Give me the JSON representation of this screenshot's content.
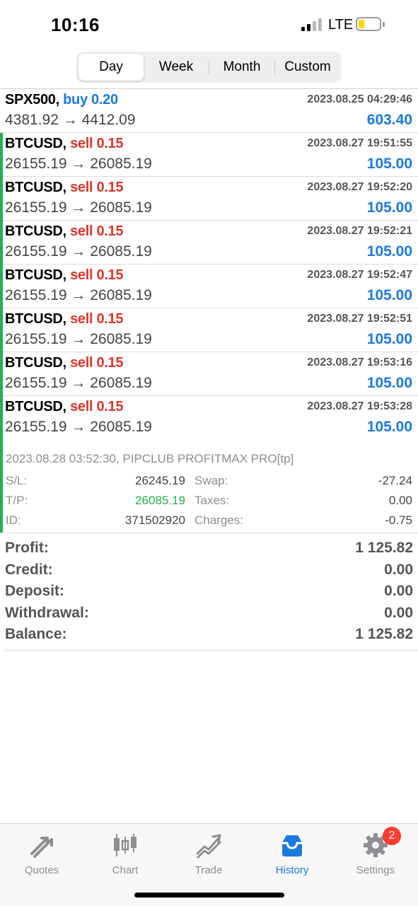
{
  "status_bar": {
    "time": "10:16",
    "network": "LTE"
  },
  "period_tabs": [
    "Day",
    "Week",
    "Month",
    "Custom"
  ],
  "active_period": "Day",
  "trades": [
    {
      "symbol": "SPX500,",
      "side": "buy 0.20",
      "side_type": "buy",
      "datetime": "2023.08.25 04:29:46",
      "prices": "4381.92 → 4412.09",
      "profit": "603.40"
    },
    {
      "symbol": "BTCUSD,",
      "side": "sell 0.15",
      "side_type": "sell",
      "datetime": "2023.08.27 19:51:55",
      "prices": "26155.19 → 26085.19",
      "profit": "105.00"
    },
    {
      "symbol": "BTCUSD,",
      "side": "sell 0.15",
      "side_type": "sell",
      "datetime": "2023.08.27 19:52:20",
      "prices": "26155.19 → 26085.19",
      "profit": "105.00"
    },
    {
      "symbol": "BTCUSD,",
      "side": "sell 0.15",
      "side_type": "sell",
      "datetime": "2023.08.27 19:52:21",
      "prices": "26155.19 → 26085.19",
      "profit": "105.00"
    },
    {
      "symbol": "BTCUSD,",
      "side": "sell 0.15",
      "side_type": "sell",
      "datetime": "2023.08.27 19:52:47",
      "prices": "26155.19 → 26085.19",
      "profit": "105.00"
    },
    {
      "symbol": "BTCUSD,",
      "side": "sell 0.15",
      "side_type": "sell",
      "datetime": "2023.08.27 19:52:51",
      "prices": "26155.19 → 26085.19",
      "profit": "105.00"
    },
    {
      "symbol": "BTCUSD,",
      "side": "sell 0.15",
      "side_type": "sell",
      "datetime": "2023.08.27 19:53:16",
      "prices": "26155.19 → 26085.19",
      "profit": "105.00"
    }
  ],
  "expanded_trade": {
    "symbol": "BTCUSD,",
    "side": "sell 0.15",
    "datetime": "2023.08.27 19:53:28",
    "prices": "26155.19 → 26085.19",
    "profit": "105.00",
    "comment": "2023.08.28 03:52:30, PIPCLUB PROFITMAX PRO[tp]",
    "sl_label": "S/L:",
    "sl_value": "26245.19",
    "tp_label": "T/P:",
    "tp_value": "26085.19",
    "id_label": "ID:",
    "id_value": "371502920",
    "swap_label": "Swap:",
    "swap_value": "-27.24",
    "taxes_label": "Taxes:",
    "taxes_value": "0.00",
    "charges_label": "Charges:",
    "charges_value": "-0.75"
  },
  "summary": [
    {
      "label": "Profit:",
      "value": "1 125.82"
    },
    {
      "label": "Credit:",
      "value": "0.00"
    },
    {
      "label": "Deposit:",
      "value": "0.00"
    },
    {
      "label": "Withdrawal:",
      "value": "0.00"
    },
    {
      "label": "Balance:",
      "value": "1 125.82"
    }
  ],
  "tab_bar": {
    "quotes": "Quotes",
    "chart": "Chart",
    "trade": "Trade",
    "history": "History",
    "settings": "Settings",
    "settings_badge": "2"
  },
  "colors": {
    "buy": "#1a7ae0",
    "sell": "#e0352b",
    "active_tab": "#1a7ae0",
    "tp_green": "#22b14c",
    "row_marker": "#22b14c",
    "badge": "#ff3b30"
  }
}
